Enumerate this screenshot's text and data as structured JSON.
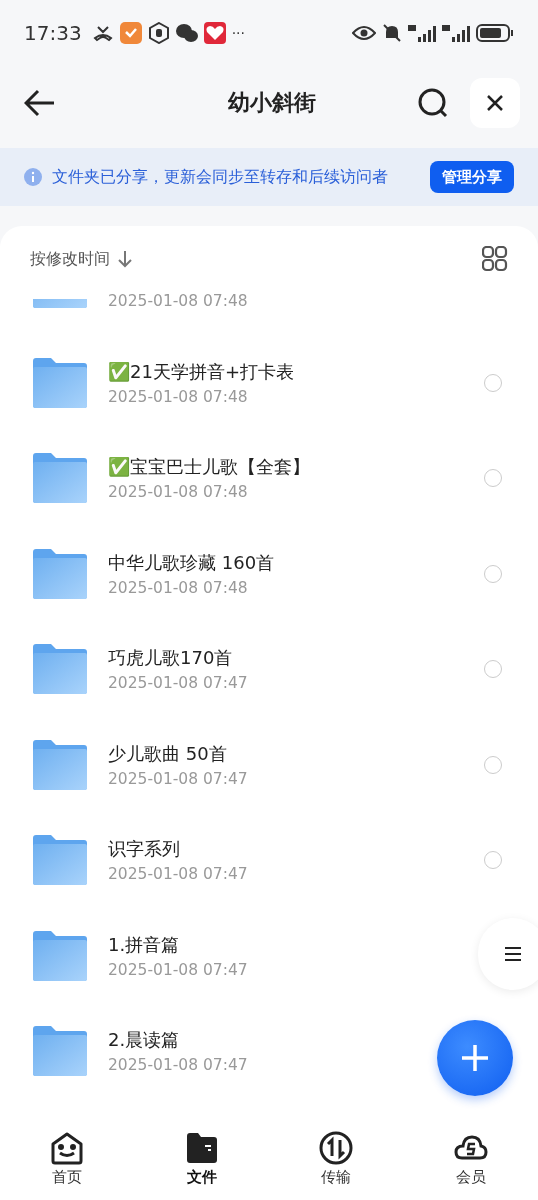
{
  "status_bar": {
    "time": "17:33",
    "more": "···"
  },
  "header": {
    "title": "幼小斜街"
  },
  "banner": {
    "text": "文件夹已分享，更新会同步至转存和后续访问者",
    "button": "管理分享"
  },
  "sort": {
    "label": "按修改时间"
  },
  "files": [
    {
      "kind": "partial",
      "date": "2025-01-08 07:48"
    },
    {
      "kind": "folder",
      "name": "✅21天学拼音+打卡表",
      "date": "2025-01-08 07:48",
      "checked": false
    },
    {
      "kind": "folder",
      "name": "✅宝宝巴士儿歌【全套】",
      "date": "2025-01-08 07:48",
      "checked": false
    },
    {
      "kind": "folder",
      "name": "中华儿歌珍藏 160首",
      "date": "2025-01-08 07:48",
      "checked": false
    },
    {
      "kind": "folder",
      "name": "巧虎儿歌170首",
      "date": "2025-01-08 07:47",
      "checked": false
    },
    {
      "kind": "folder",
      "name": "少儿歌曲 50首",
      "date": "2025-01-08 07:47",
      "checked": false
    },
    {
      "kind": "folder",
      "name": "识字系列",
      "date": "2025-01-08 07:47",
      "checked": false
    },
    {
      "kind": "folder",
      "name": "1.拼音篇",
      "date": "2025-01-08 07:47"
    },
    {
      "kind": "folder",
      "name": "2.晨读篇",
      "date": "2025-01-08 07:47"
    }
  ],
  "nav": [
    {
      "label": "首页",
      "kind": "home",
      "selected": false
    },
    {
      "label": "文件",
      "kind": "folder",
      "selected": true
    },
    {
      "label": "传输",
      "kind": "transfer",
      "selected": false
    },
    {
      "label": "会员",
      "kind": "cloud",
      "selected": false
    }
  ]
}
